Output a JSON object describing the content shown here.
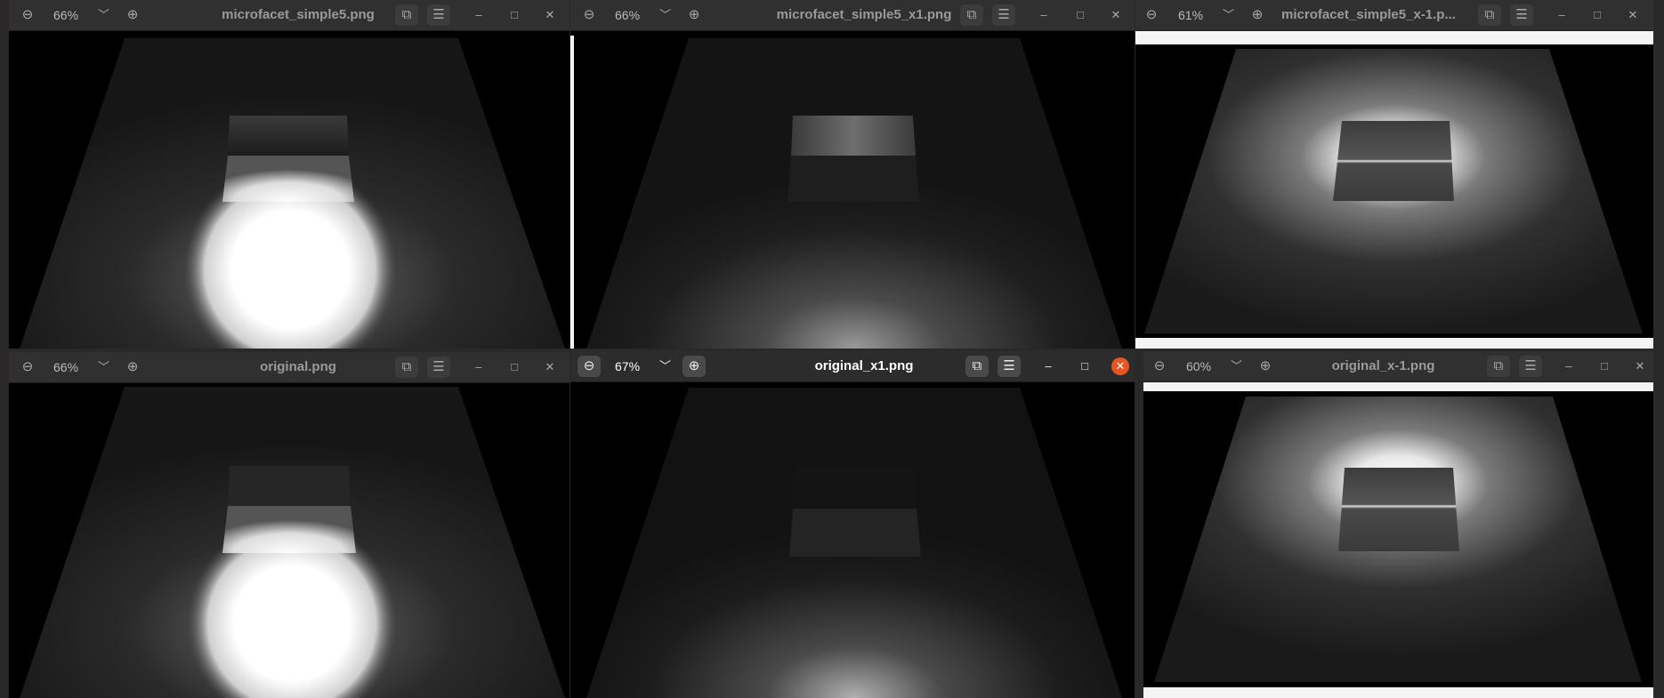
{
  "windows": [
    {
      "id": "w1",
      "zoom": "66%",
      "title": "microfacet_simple5.png",
      "active": false
    },
    {
      "id": "w2",
      "zoom": "66%",
      "title": "microfacet_simple5_x1.png",
      "active": false
    },
    {
      "id": "w3",
      "zoom": "61%",
      "title": "microfacet_simple5_x-1.p...",
      "active": false
    },
    {
      "id": "w4",
      "zoom": "66%",
      "title": "original.png",
      "active": false
    },
    {
      "id": "w5",
      "zoom": "67%",
      "title": "original_x1.png",
      "active": true
    },
    {
      "id": "w6",
      "zoom": "60%",
      "title": "original_x-1.png",
      "active": false
    }
  ],
  "icons": {
    "zoom_out": "zoom-out-icon",
    "zoom_dropdown": "chevron-down-icon",
    "zoom_in": "zoom-in-icon",
    "restore": "restore-icon",
    "menu": "hamburger-menu-icon",
    "minimize": "minimize-icon",
    "maximize": "maximize-icon",
    "close": "close-icon"
  },
  "colors": {
    "close_active": "#e95420",
    "titlebar": "#303030",
    "image_background": "#000000"
  }
}
